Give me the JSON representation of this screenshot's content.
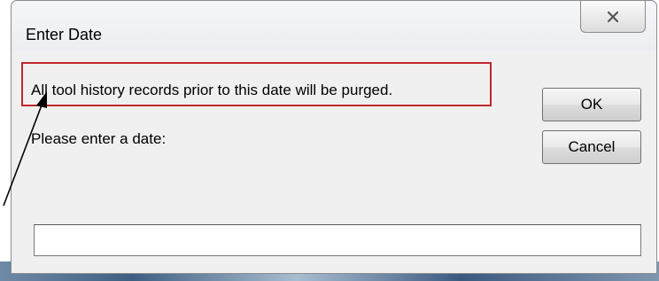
{
  "dialog": {
    "title": "Enter Date",
    "message": "All tool history records prior to this date will be purged.",
    "prompt": "Please enter a date:",
    "date_value": "",
    "ok_label": "OK",
    "cancel_label": "Cancel"
  },
  "annotation": {
    "highlight_color": "#c0272d",
    "arrow_color": "#000000"
  }
}
